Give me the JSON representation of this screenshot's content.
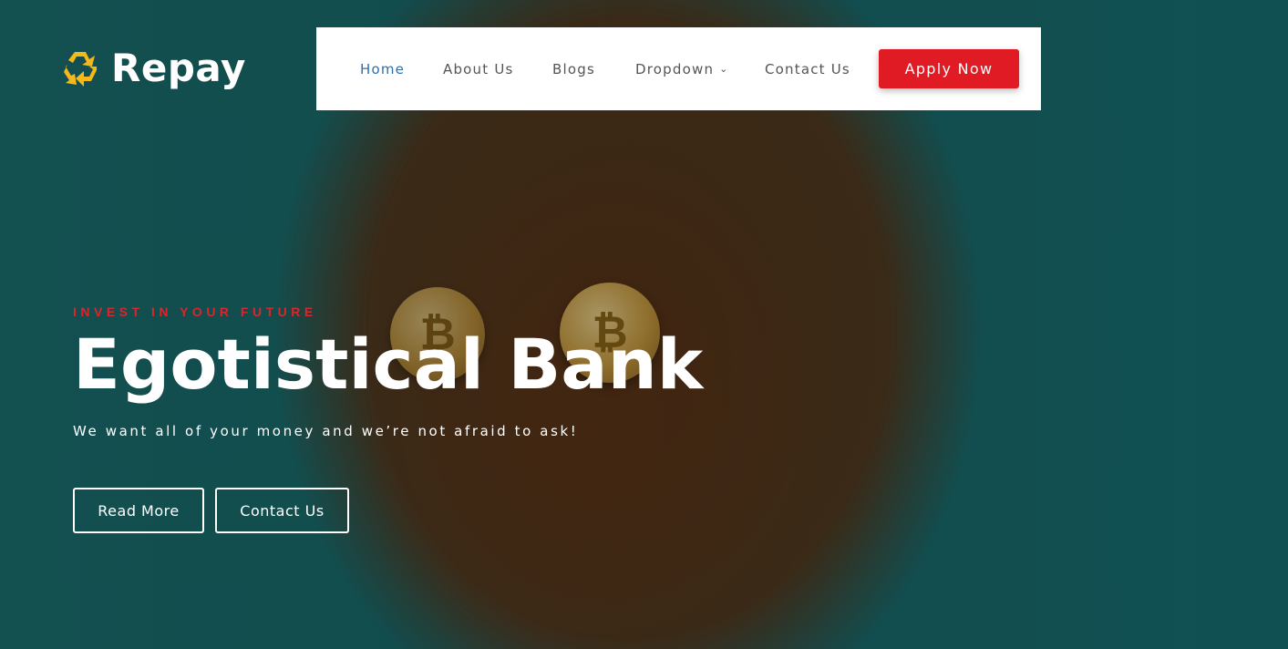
{
  "brand": {
    "name": "Repay",
    "icon": "recycle-icon",
    "icon_color": "#f5b819"
  },
  "nav": {
    "items": [
      {
        "label": "Home",
        "active": true
      },
      {
        "label": "About Us"
      },
      {
        "label": "Blogs"
      },
      {
        "label": "Dropdown",
        "has_dropdown": true,
        "icon": "chevron-down-icon"
      },
      {
        "label": "Contact Us"
      }
    ],
    "cta_label": "Apply Now",
    "active_color": "#2a6fb0",
    "cta_color": "#e01b24"
  },
  "hero": {
    "eyebrow": "INVEST IN YOUR FUTURE",
    "title": "Egotistical Bank",
    "subtitle": "We want all of your money and we’re not afraid to ask!",
    "buttons": [
      {
        "label": "Read More"
      },
      {
        "label": "Contact Us"
      }
    ],
    "eyebrow_color": "#d9262c"
  }
}
